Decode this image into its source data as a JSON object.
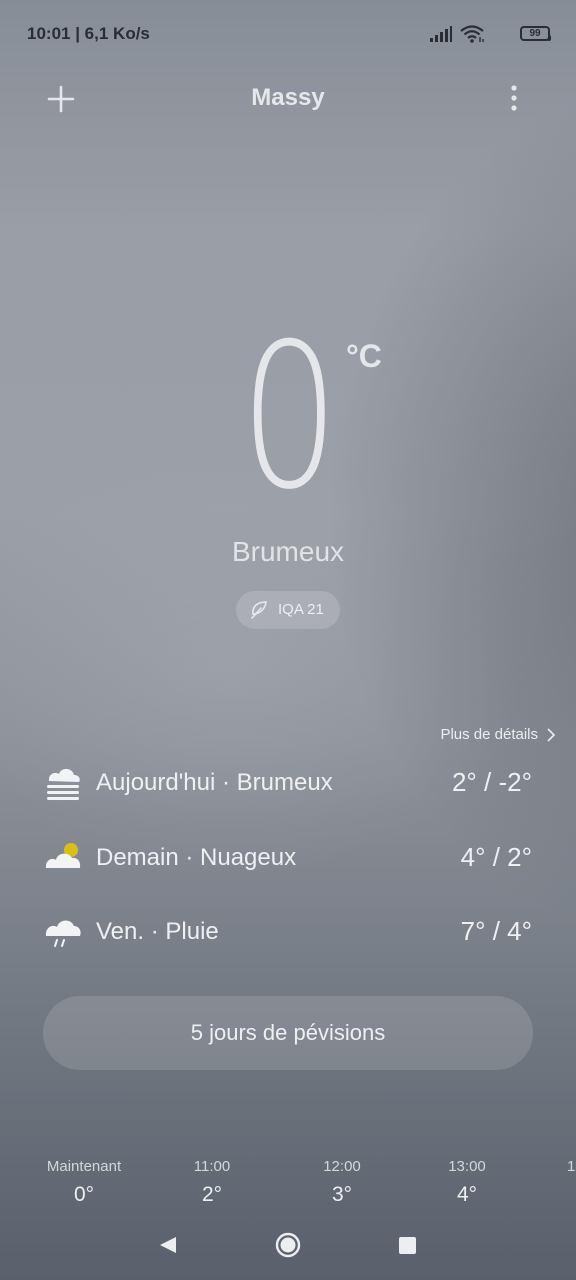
{
  "status_bar": {
    "time_speed": "10:01 | 6,1 Ko/s",
    "battery": "99"
  },
  "header": {
    "city": "Massy",
    "add_icon": "plus-icon",
    "menu_icon": "vertical-dots-icon"
  },
  "current": {
    "temperature": "0",
    "unit": "°C",
    "condition": "Brumeux",
    "aqi_label": "IQA 21",
    "aqi_icon": "leaf-icon"
  },
  "details_link": "Plus de détails",
  "forecast": [
    {
      "label": "Aujourd'hui · Brumeux",
      "temps": "2° / -2°",
      "icon": "fog-icon"
    },
    {
      "label": "Demain · Nuageux",
      "temps": "4° / 2°",
      "icon": "partly-cloudy-icon"
    },
    {
      "label": "Ven. · Pluie",
      "temps": "7° / 4°",
      "icon": "rain-icon"
    }
  ],
  "five_day_button": "5 jours de pévisions",
  "hourly": [
    {
      "time": "Maintenant",
      "temp": "0°"
    },
    {
      "time": "11:00",
      "temp": "2°"
    },
    {
      "time": "12:00",
      "temp": "3°"
    },
    {
      "time": "13:00",
      "temp": "4°"
    },
    {
      "time": "1",
      "temp": ""
    }
  ],
  "colors": {
    "sun": "#d8c017",
    "text": "#eff0f2",
    "status_text": "#2a2d33"
  }
}
